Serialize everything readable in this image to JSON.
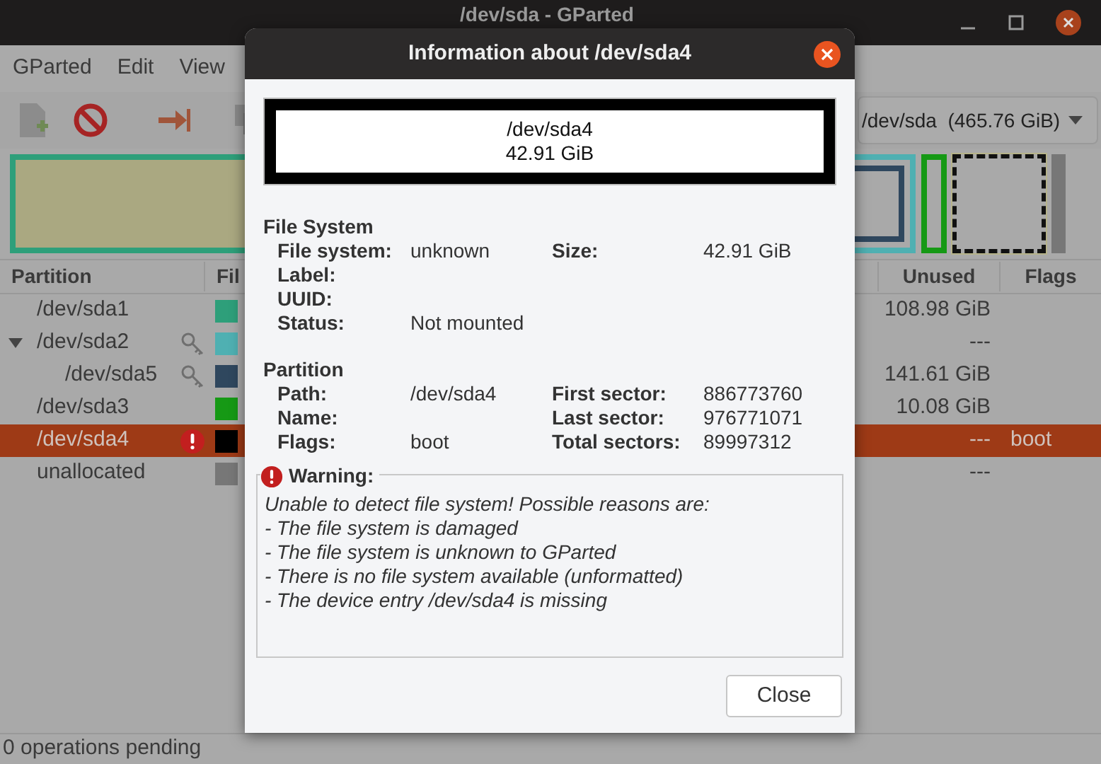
{
  "window": {
    "title": "/dev/sda - GParted"
  },
  "menu": [
    "GParted",
    "Edit",
    "View"
  ],
  "device_selector": {
    "value": "/dev/sda  (465.76 GiB)"
  },
  "table": {
    "columns": [
      "Partition",
      "Fil",
      "Unused",
      "Flags"
    ],
    "rows": [
      {
        "partition": "/dev/sda1",
        "color": "#2e9f7a",
        "kind": "plain",
        "selected": false,
        "unused": "108.98 GiB"
      },
      {
        "partition": "/dev/sda2",
        "color": "#4fb0b2",
        "kind": "mounted",
        "selected": false,
        "expanded": true,
        "unused": "---",
        "children": [
          {
            "partition": "/dev/sda5",
            "color": "#2f475e",
            "kind": "mounted",
            "selected": false,
            "unused": "141.61 GiB"
          }
        ]
      },
      {
        "partition": "/dev/sda3",
        "color": "#169915",
        "kind": "plain",
        "selected": false,
        "unused": "10.08 GiB"
      },
      {
        "partition": "/dev/sda4",
        "color": "#000000",
        "kind": "error",
        "selected": true,
        "unused": "---",
        "flags": "boot"
      },
      {
        "partition": "unallocated",
        "color": "#777777",
        "kind": "plain",
        "selected": false,
        "unused": "---"
      }
    ]
  },
  "status_bar": "0 operations pending",
  "dialog": {
    "title": "Information about /dev/sda4",
    "graphic": {
      "path": "/dev/sda4",
      "size": "42.91 GiB"
    },
    "sections": [
      {
        "heading": "File System",
        "rows": [
          [
            {
              "label": "File system:",
              "value": "unknown"
            },
            {
              "label": "Size:",
              "value": "42.91 GiB"
            }
          ],
          [
            {
              "label": "Label:"
            }
          ],
          [
            {
              "label": "UUID:"
            }
          ],
          [
            {
              "label": "Status:",
              "value": "Not mounted"
            }
          ]
        ]
      },
      {
        "heading": "Partition",
        "rows": [
          [
            {
              "label": "Path:",
              "value": "/dev/sda4"
            },
            {
              "label": "First sector:",
              "value": "886773760"
            }
          ],
          [
            {
              "label": "Name:"
            },
            {
              "label": "Last sector:",
              "value": "976771071"
            }
          ],
          [
            {
              "label": "Flags:",
              "value": "boot"
            },
            {
              "label": "Total sectors:",
              "value": "89997312"
            }
          ]
        ]
      }
    ],
    "warning": {
      "title": "Warning:",
      "lines": [
        "Unable to detect file system! Possible reasons are:",
        "- The file system is damaged",
        "- The file system is unknown to GParted",
        "- There is no file system available (unformatted)",
        "- The device entry /dev/sda4 is missing"
      ]
    },
    "button": "Close"
  }
}
